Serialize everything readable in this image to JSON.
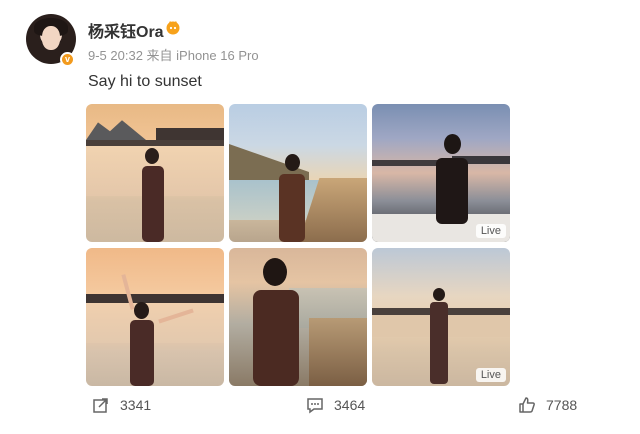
{
  "post": {
    "username": "杨采钰Ora",
    "meta": "9-5 20:32  来自 iPhone 16 Pro",
    "text": "Say hi to sunset"
  },
  "images": [
    {
      "scene": "sunset pier beach with hills",
      "live_label": ""
    },
    {
      "scene": "seaside boardwalk golden hour",
      "live_label": ""
    },
    {
      "scene": "dusk seaside dinner table",
      "live_label": "Live"
    },
    {
      "scene": "sunset beach arms raised",
      "live_label": ""
    },
    {
      "scene": "boardwalk portrait",
      "live_label": ""
    },
    {
      "scene": "beach full body at sunset",
      "live_label": "Live"
    }
  ],
  "actions": {
    "share_count": "3341",
    "comment_count": "3464",
    "like_count": "7788"
  },
  "colors": {
    "verified_badge": "#f29a1d",
    "meta_text": "#939393"
  },
  "icons": [
    "share-icon",
    "comment-icon",
    "like-icon",
    "verified-icon",
    "vip-icon"
  ]
}
